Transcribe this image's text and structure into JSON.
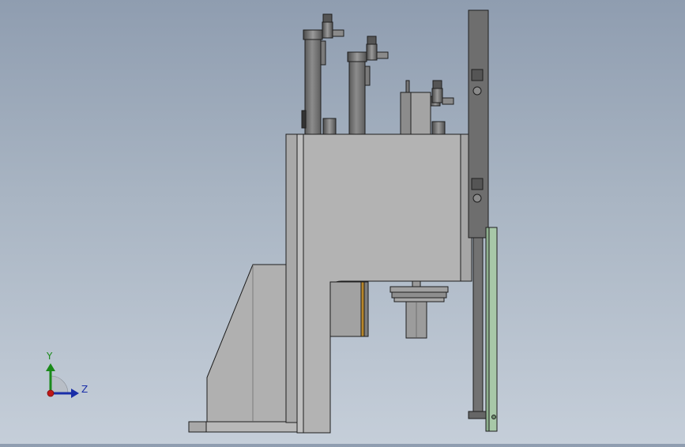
{
  "triad": {
    "y_label": "Y",
    "z_label": "Z",
    "y_color": "#1a8a1a",
    "z_color": "#1a2ea8",
    "x_color": "#c01818"
  },
  "colors": {
    "background_top": "#8f9db0",
    "background_bottom": "#c5ced9",
    "part_gray": "#b3b3b3",
    "part_light": "#c4c4c4",
    "part_dark": "#6f6f6f",
    "outline": "#1e1e1e",
    "green_plate": "#a8c8a8",
    "brass": "#b8862a"
  }
}
